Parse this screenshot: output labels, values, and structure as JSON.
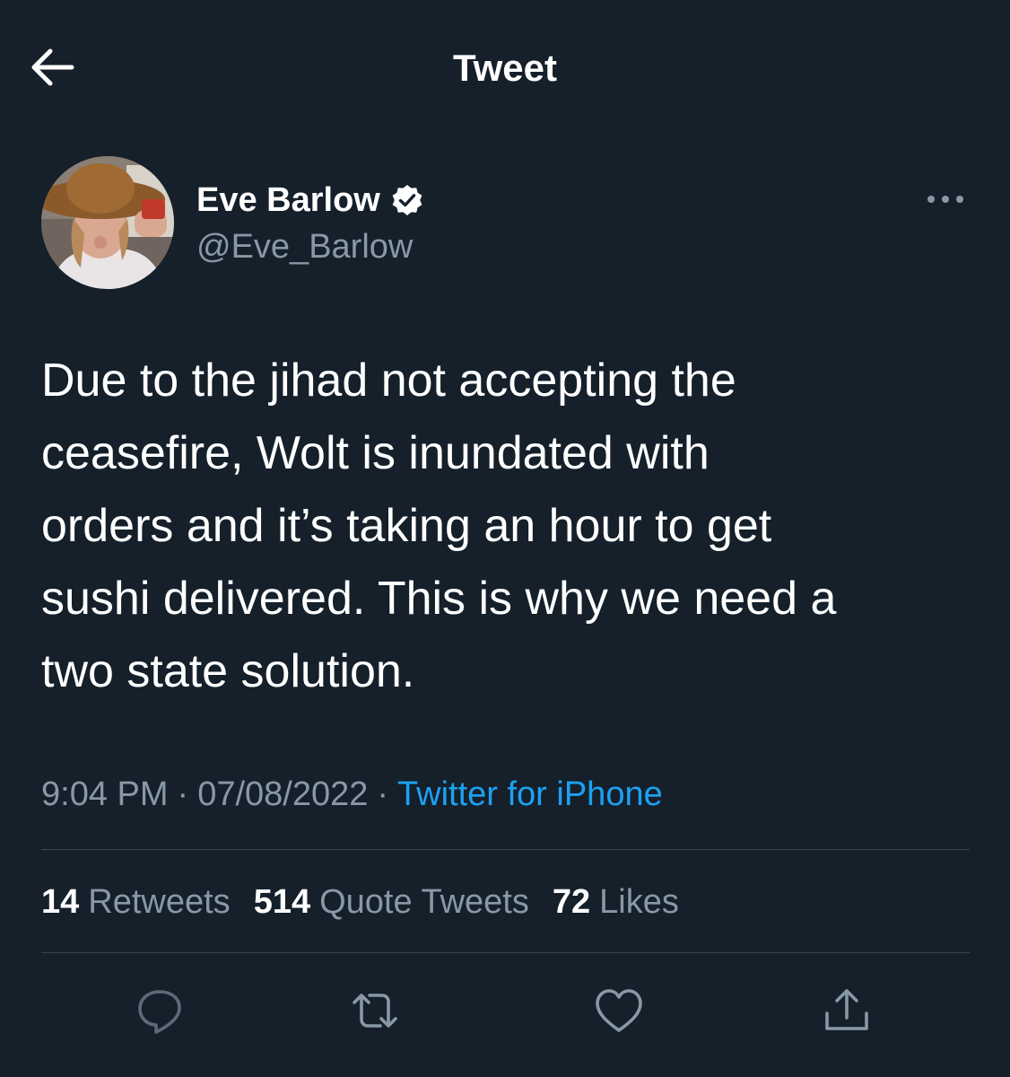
{
  "header": {
    "title": "Tweet",
    "back_icon": "arrow-left-icon"
  },
  "author": {
    "display_name": "Eve Barlow",
    "handle": "@Eve_Barlow",
    "verified": true
  },
  "tweet": {
    "text": "Due to the jihad not accepting the\nceasefire, Wolt is inundated with\norders and it’s taking an hour to get\nsushi delivered. This is why we need a\ntwo state solution.",
    "time": "9:04 PM",
    "date": "07/08/2022",
    "separator": "·",
    "source": "Twitter for iPhone"
  },
  "stats": {
    "retweets_count": "14",
    "retweets_label": "Retweets",
    "quotes_count": "514",
    "quotes_label": "Quote Tweets",
    "likes_count": "72",
    "likes_label": "Likes"
  },
  "actions": [
    "reply-icon",
    "retweet-icon",
    "like-icon",
    "share-icon"
  ],
  "colors": {
    "background": "#15202b",
    "text": "#ffffff",
    "secondary": "#8899a6",
    "link": "#1da1f2",
    "divider": "#38444d"
  }
}
